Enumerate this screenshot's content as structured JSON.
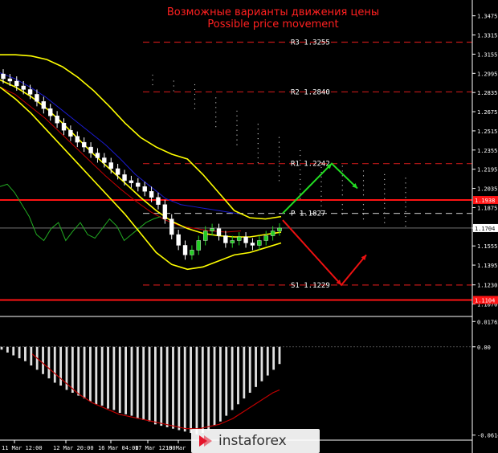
{
  "title_lines": [
    "Возможные варианты движения цены",
    "Possible price movement"
  ],
  "brand": "instaforex",
  "colors": {
    "background": "#000000",
    "axis": "#ffffff",
    "grid_dash": "#505050",
    "level_line": "#c01818",
    "strong_level": "#ff1414",
    "bollinger": "#ffff00",
    "moving_average_red": "#c00000",
    "moving_average_blue": "#1a1ad0",
    "rsi_green": "#22aa22",
    "ichimoku_cloud": "#d8d8d8",
    "bullish_arrow": "#22dd22",
    "bearish_arrow": "#ee1111",
    "histogram_bar": "#e0e0e0",
    "signal_line": "#c00000"
  },
  "chart_data": [
    {
      "type": "candlestick",
      "panel": "price",
      "instrument": "",
      "y_ticks": [
        1.3475,
        1.3315,
        1.3155,
        1.2995,
        1.2835,
        1.2675,
        1.2515,
        1.2355,
        1.2195,
        1.2035,
        1.1875,
        1.1704,
        1.1555,
        1.1395,
        1.123,
        1.107
      ],
      "ylim": [
        1.098,
        1.358
      ],
      "current_price": 1.1704,
      "levels": [
        {
          "name": "R3",
          "value": 1.3255,
          "label": "R3  1.3255"
        },
        {
          "name": "R2",
          "value": 1.284,
          "label": "R2  1.2840"
        },
        {
          "name": "R1",
          "value": 1.2242,
          "label": "R1  1.2242"
        },
        {
          "name": "P",
          "value": 1.1827,
          "label": "P  1.1827"
        },
        {
          "name": "S1",
          "value": 1.1229,
          "label": "S1  1.1229"
        }
      ],
      "strong_levels": [
        {
          "value": 1.1938,
          "label": "1.1938"
        },
        {
          "value": 1.1104,
          "label": "1.1104"
        }
      ],
      "x_labels": [
        "11 Mar 12:00",
        "12 Mar 20:00",
        "16 Mar 04:00",
        "17 Mar 12:00",
        "18 Mar"
      ],
      "candles_close": [
        1.295,
        1.293,
        1.289,
        1.286,
        1.282,
        1.276,
        1.27,
        1.264,
        1.258,
        1.252,
        1.247,
        1.242,
        1.238,
        1.233,
        1.229,
        1.225,
        1.22,
        1.215,
        1.21,
        1.208,
        1.205,
        1.201,
        1.196,
        1.19,
        1.178,
        1.165,
        1.156,
        1.148,
        1.152,
        1.16,
        1.168,
        1.17,
        1.164,
        1.158,
        1.16,
        1.163,
        1.158,
        1.156,
        1.16,
        1.164,
        1.168,
        1.1704
      ],
      "bollinger_upper": [
        1.315,
        1.315,
        1.314,
        1.311,
        1.305,
        1.296,
        1.285,
        1.272,
        1.258,
        1.246,
        1.238,
        1.232,
        1.228,
        1.215,
        1.2,
        1.185,
        1.179,
        1.178,
        1.18
      ],
      "bollinger_middle": [
        1.294,
        1.288,
        1.28,
        1.27,
        1.258,
        1.245,
        1.232,
        1.22,
        1.208,
        1.196,
        1.185,
        1.176,
        1.17,
        1.166,
        1.164,
        1.163,
        1.163,
        1.165,
        1.167
      ],
      "bollinger_lower": [
        1.288,
        1.278,
        1.266,
        1.252,
        1.238,
        1.224,
        1.21,
        1.196,
        1.182,
        1.166,
        1.15,
        1.14,
        1.136,
        1.138,
        1.143,
        1.148,
        1.15,
        1.154,
        1.158
      ],
      "rsi_line": [
        1.205,
        1.207,
        1.2,
        1.19,
        1.18,
        1.165,
        1.16,
        1.17,
        1.175,
        1.16,
        1.168,
        1.175,
        1.165,
        1.162,
        1.17,
        1.178,
        1.172,
        1.16,
        1.165,
        1.17,
        1.175,
        1.178,
        1.18
      ],
      "forecast": {
        "bullish": [
          {
            "x": 0,
            "y": 1.1827
          },
          {
            "x": 1,
            "y": 1.2242
          },
          {
            "x": 2,
            "y": 1.2035
          }
        ],
        "bearish": [
          {
            "x": 0,
            "y": 1.177
          },
          {
            "x": 1,
            "y": 1.1229
          },
          {
            "x": 2,
            "y": 1.148
          }
        ]
      }
    },
    {
      "type": "bar",
      "panel": "oscillator",
      "y_ticks": [
        0.01762,
        0.0,
        -0.06149
      ],
      "ylim": [
        -0.065,
        0.02
      ],
      "values": [
        -0.002,
        -0.004,
        -0.006,
        -0.008,
        -0.01,
        -0.013,
        -0.016,
        -0.019,
        -0.022,
        -0.025,
        -0.027,
        -0.03,
        -0.032,
        -0.034,
        -0.036,
        -0.038,
        -0.04,
        -0.041,
        -0.043,
        -0.044,
        -0.046,
        -0.047,
        -0.048,
        -0.05,
        -0.051,
        -0.052,
        -0.054,
        -0.055,
        -0.056,
        -0.057,
        -0.058,
        -0.059,
        -0.06,
        -0.061,
        -0.06,
        -0.058,
        -0.055,
        -0.052,
        -0.048,
        -0.044,
        -0.04,
        -0.036,
        -0.032,
        -0.028,
        -0.024,
        -0.02,
        -0.016,
        -0.012
      ],
      "signal": [
        -0.005,
        -0.009,
        -0.013,
        -0.017,
        -0.021,
        -0.025,
        -0.029,
        -0.033,
        -0.036,
        -0.039,
        -0.041,
        -0.043,
        -0.045,
        -0.047,
        -0.048,
        -0.049,
        -0.05,
        -0.051,
        -0.052,
        -0.053,
        -0.054,
        -0.055,
        -0.056,
        -0.057,
        -0.057,
        -0.057,
        -0.056,
        -0.055,
        -0.054,
        -0.052,
        -0.05,
        -0.047,
        -0.044,
        -0.041,
        -0.038,
        -0.035,
        -0.032,
        -0.03
      ]
    }
  ]
}
